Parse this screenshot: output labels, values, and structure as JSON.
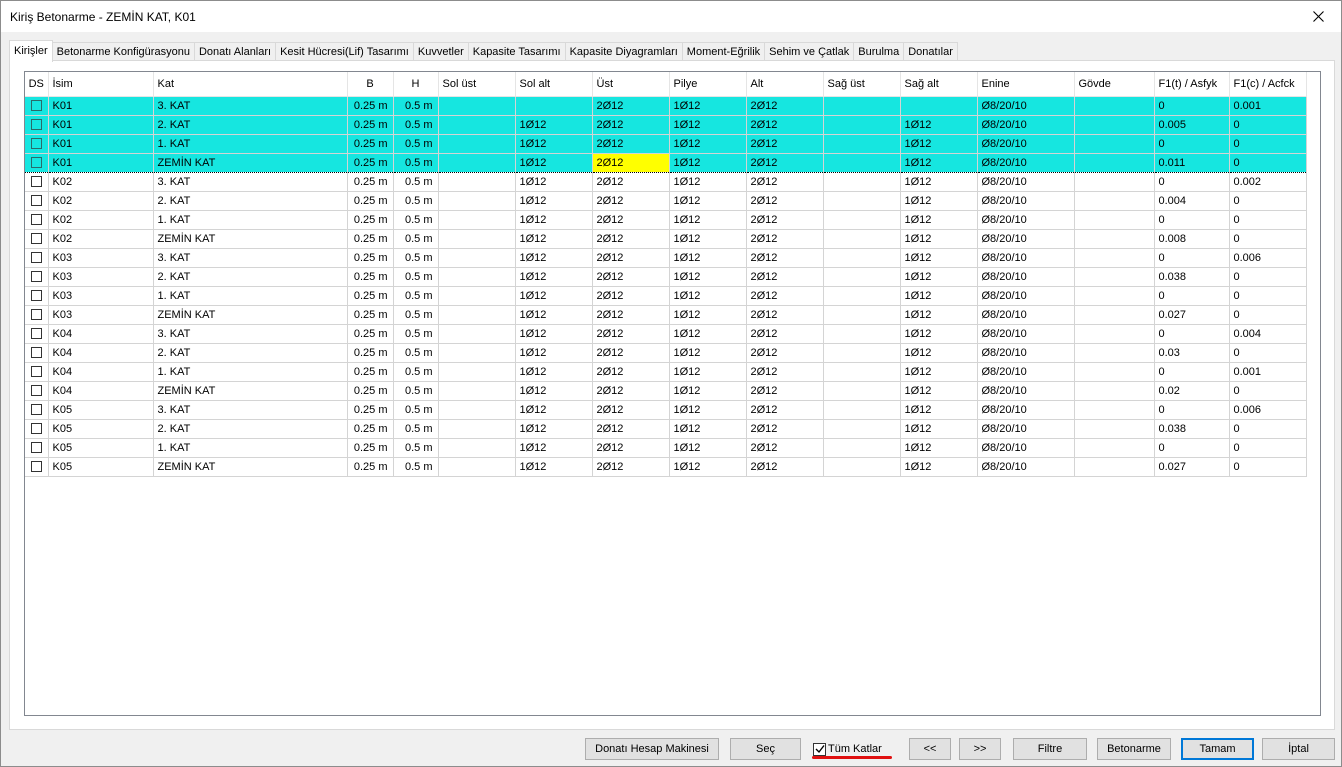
{
  "window": {
    "title": "Kiriş Betonarme - ZEMİN KAT, K01"
  },
  "tabs": [
    {
      "label": "Kirişler",
      "active": true
    },
    {
      "label": "Betonarme Konfigürasyonu"
    },
    {
      "label": "Donatı Alanları"
    },
    {
      "label": "Kesit Hücresi(Lif) Tasarımı"
    },
    {
      "label": "Kuvvetler"
    },
    {
      "label": "Kapasite Tasarımı"
    },
    {
      "label": "Kapasite Diyagramları"
    },
    {
      "label": "Moment-Eğrilik"
    },
    {
      "label": "Sehim ve Çatlak"
    },
    {
      "label": "Burulma"
    },
    {
      "label": "Donatılar"
    }
  ],
  "grid": {
    "columns": [
      "DS",
      "İsim",
      "Kat",
      "B",
      "H",
      "Sol üst",
      "Sol alt",
      "Üst",
      "Pilye",
      "Alt",
      "Sağ üst",
      "Sağ alt",
      "Enine",
      "Gövde",
      "F1(t) / Asfyk",
      "F1(c) / Acfck"
    ],
    "rows": [
      [
        "K01",
        "3. KAT",
        "0.25 m",
        "0.5 m",
        "",
        "",
        "2Ø12",
        "1Ø12",
        "2Ø12",
        "",
        "",
        "Ø8/20/10",
        "",
        "0",
        "0.001"
      ],
      [
        "K01",
        "2. KAT",
        "0.25 m",
        "0.5 m",
        "",
        "1Ø12",
        "2Ø12",
        "1Ø12",
        "2Ø12",
        "",
        "1Ø12",
        "Ø8/20/10",
        "",
        "0.005",
        "0"
      ],
      [
        "K01",
        "1. KAT",
        "0.25 m",
        "0.5 m",
        "",
        "1Ø12",
        "2Ø12",
        "1Ø12",
        "2Ø12",
        "",
        "1Ø12",
        "Ø8/20/10",
        "",
        "0",
        "0"
      ],
      [
        "K01",
        "ZEMİN KAT",
        "0.25 m",
        "0.5 m",
        "",
        "1Ø12",
        "2Ø12",
        "1Ø12",
        "2Ø12",
        "",
        "1Ø12",
        "Ø8/20/10",
        "",
        "0.011",
        "0"
      ],
      [
        "K02",
        "3. KAT",
        "0.25 m",
        "0.5 m",
        "",
        "1Ø12",
        "2Ø12",
        "1Ø12",
        "2Ø12",
        "",
        "1Ø12",
        "Ø8/20/10",
        "",
        "0",
        "0.002"
      ],
      [
        "K02",
        "2. KAT",
        "0.25 m",
        "0.5 m",
        "",
        "1Ø12",
        "2Ø12",
        "1Ø12",
        "2Ø12",
        "",
        "1Ø12",
        "Ø8/20/10",
        "",
        "0.004",
        "0"
      ],
      [
        "K02",
        "1. KAT",
        "0.25 m",
        "0.5 m",
        "",
        "1Ø12",
        "2Ø12",
        "1Ø12",
        "2Ø12",
        "",
        "1Ø12",
        "Ø8/20/10",
        "",
        "0",
        "0"
      ],
      [
        "K02",
        "ZEMİN KAT",
        "0.25 m",
        "0.5 m",
        "",
        "1Ø12",
        "2Ø12",
        "1Ø12",
        "2Ø12",
        "",
        "1Ø12",
        "Ø8/20/10",
        "",
        "0.008",
        "0"
      ],
      [
        "K03",
        "3. KAT",
        "0.25 m",
        "0.5 m",
        "",
        "1Ø12",
        "2Ø12",
        "1Ø12",
        "2Ø12",
        "",
        "1Ø12",
        "Ø8/20/10",
        "",
        "0",
        "0.006"
      ],
      [
        "K03",
        "2. KAT",
        "0.25 m",
        "0.5 m",
        "",
        "1Ø12",
        "2Ø12",
        "1Ø12",
        "2Ø12",
        "",
        "1Ø12",
        "Ø8/20/10",
        "",
        "0.038",
        "0"
      ],
      [
        "K03",
        "1. KAT",
        "0.25 m",
        "0.5 m",
        "",
        "1Ø12",
        "2Ø12",
        "1Ø12",
        "2Ø12",
        "",
        "1Ø12",
        "Ø8/20/10",
        "",
        "0",
        "0"
      ],
      [
        "K03",
        "ZEMİN KAT",
        "0.25 m",
        "0.5 m",
        "",
        "1Ø12",
        "2Ø12",
        "1Ø12",
        "2Ø12",
        "",
        "1Ø12",
        "Ø8/20/10",
        "",
        "0.027",
        "0"
      ],
      [
        "K04",
        "3. KAT",
        "0.25 m",
        "0.5 m",
        "",
        "1Ø12",
        "2Ø12",
        "1Ø12",
        "2Ø12",
        "",
        "1Ø12",
        "Ø8/20/10",
        "",
        "0",
        "0.004"
      ],
      [
        "K04",
        "2. KAT",
        "0.25 m",
        "0.5 m",
        "",
        "1Ø12",
        "2Ø12",
        "1Ø12",
        "2Ø12",
        "",
        "1Ø12",
        "Ø8/20/10",
        "",
        "0.03",
        "0"
      ],
      [
        "K04",
        "1. KAT",
        "0.25 m",
        "0.5 m",
        "",
        "1Ø12",
        "2Ø12",
        "1Ø12",
        "2Ø12",
        "",
        "1Ø12",
        "Ø8/20/10",
        "",
        "0",
        "0.001"
      ],
      [
        "K04",
        "ZEMİN KAT",
        "0.25 m",
        "0.5 m",
        "",
        "1Ø12",
        "2Ø12",
        "1Ø12",
        "2Ø12",
        "",
        "1Ø12",
        "Ø8/20/10",
        "",
        "0.02",
        "0"
      ],
      [
        "K05",
        "3. KAT",
        "0.25 m",
        "0.5 m",
        "",
        "1Ø12",
        "2Ø12",
        "1Ø12",
        "2Ø12",
        "",
        "1Ø12",
        "Ø8/20/10",
        "",
        "0",
        "0.006"
      ],
      [
        "K05",
        "2. KAT",
        "0.25 m",
        "0.5 m",
        "",
        "1Ø12",
        "2Ø12",
        "1Ø12",
        "2Ø12",
        "",
        "1Ø12",
        "Ø8/20/10",
        "",
        "0.038",
        "0"
      ],
      [
        "K05",
        "1. KAT",
        "0.25 m",
        "0.5 m",
        "",
        "1Ø12",
        "2Ø12",
        "1Ø12",
        "2Ø12",
        "",
        "1Ø12",
        "Ø8/20/10",
        "",
        "0",
        "0"
      ],
      [
        "K05",
        "ZEMİN KAT",
        "0.25 m",
        "0.5 m",
        "",
        "1Ø12",
        "2Ø12",
        "1Ø12",
        "2Ø12",
        "",
        "1Ø12",
        "Ø8/20/10",
        "",
        "0.027",
        "0"
      ]
    ],
    "selected_rows": [
      0,
      1,
      2,
      3
    ],
    "focused_row": 3,
    "highlight_cell": {
      "row": 3,
      "col": "Üst"
    },
    "selection_color": "#16e6e0",
    "highlight_color": "#ffff00"
  },
  "footer": {
    "calculator_label": "Donatı Hesap Makinesi",
    "select_label": "Seç",
    "all_floors_label": "Tüm Katlar",
    "all_floors_checked": true,
    "prev_label": "<<",
    "next_label": ">>",
    "filter_label": "Filtre",
    "concrete_label": "Betonarme",
    "ok_label": "Tamam",
    "cancel_label": "İptal",
    "accent_color": "#0078d7",
    "annotation_color": "#e01010"
  }
}
